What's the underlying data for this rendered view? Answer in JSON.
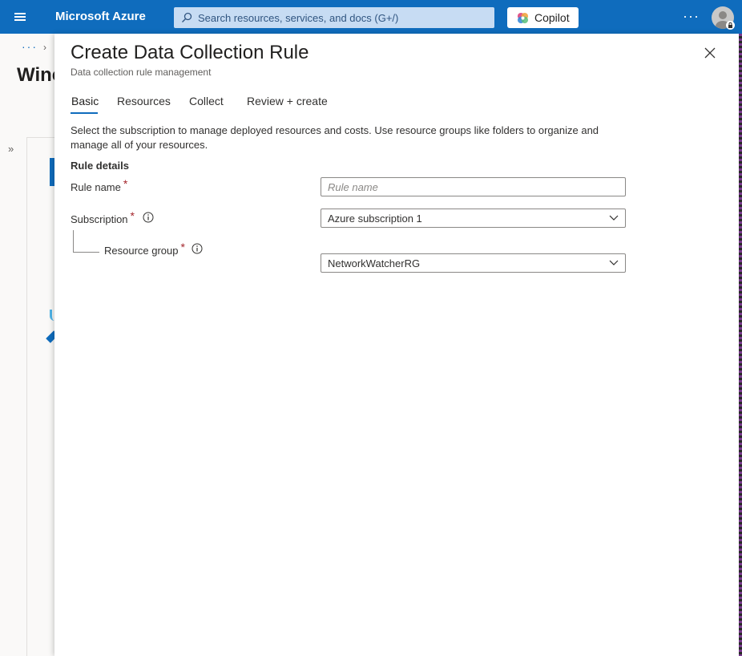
{
  "topbar": {
    "brand": "Microsoft Azure",
    "search_placeholder": "Search resources, services, and docs (G+/)",
    "copilot_label": "Copilot",
    "more_label": "···",
    "accent_color": "#0f6cbd"
  },
  "background": {
    "breadcrumb": "···",
    "breadcrumb_chevron": "›",
    "title_partial": "Winc",
    "expand_label": "»"
  },
  "panel": {
    "title": "Create Data Collection Rule",
    "subtitle": "Data collection rule management",
    "tabs": [
      {
        "label": "Basic",
        "active": true
      },
      {
        "label": "Resources",
        "active": false
      },
      {
        "label": "Collect",
        "active": false
      },
      {
        "label": "Review + create",
        "active": false
      }
    ],
    "description": "Select the subscription to manage deployed resources and costs. Use resource groups like folders to organize and manage all of your resources.",
    "section_heading": "Rule details",
    "fields": {
      "rule_name": {
        "label": "Rule name",
        "required_mark": "*",
        "value": "",
        "placeholder": "Rule name"
      },
      "subscription": {
        "label": "Subscription",
        "required_mark": "*",
        "value": "Azure subscription 1"
      },
      "resource_group": {
        "label": "Resource group",
        "required_mark": "*",
        "value": "NetworkWatcherRG"
      }
    }
  },
  "icons": [
    "hamburger-icon",
    "search-icon",
    "copilot-icon",
    "avatar-icon",
    "lock-icon",
    "close-icon",
    "info-icon",
    "chevron-down-icon"
  ]
}
